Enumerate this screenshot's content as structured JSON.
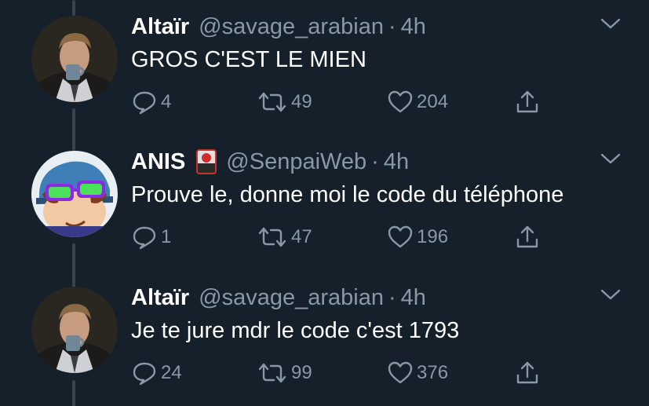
{
  "tweets": [
    {
      "display_name": "Altaïr",
      "handle": "@savage_arabian",
      "separator": "·",
      "time": "4h",
      "text": "GROS C'EST LE MIEN",
      "replies": "4",
      "retweets": "49",
      "likes": "204",
      "avatar": "man-with-teacup-avatar",
      "emoji": ""
    },
    {
      "display_name": "ANIS",
      "handle": "@SenpaiWeb",
      "separator": "·",
      "time": "4h",
      "text": "Prouve le, donne moi le code du téléphone",
      "replies": "1",
      "retweets": "47",
      "likes": "196",
      "avatar": "cartoon-boy-with-goggles-avatar",
      "emoji": "hanafuda-card-emoji"
    },
    {
      "display_name": "Altaïr",
      "handle": "@savage_arabian",
      "separator": "·",
      "time": "4h",
      "text": "Je te jure mdr le code c'est 1793",
      "replies": "24",
      "retweets": "99",
      "likes": "376",
      "avatar": "man-with-teacup-avatar",
      "emoji": ""
    }
  ],
  "colors": {
    "background": "#15202b",
    "secondary_text": "#8899a6",
    "thread_line": "#38444d",
    "primary_text": "#ffffff"
  }
}
